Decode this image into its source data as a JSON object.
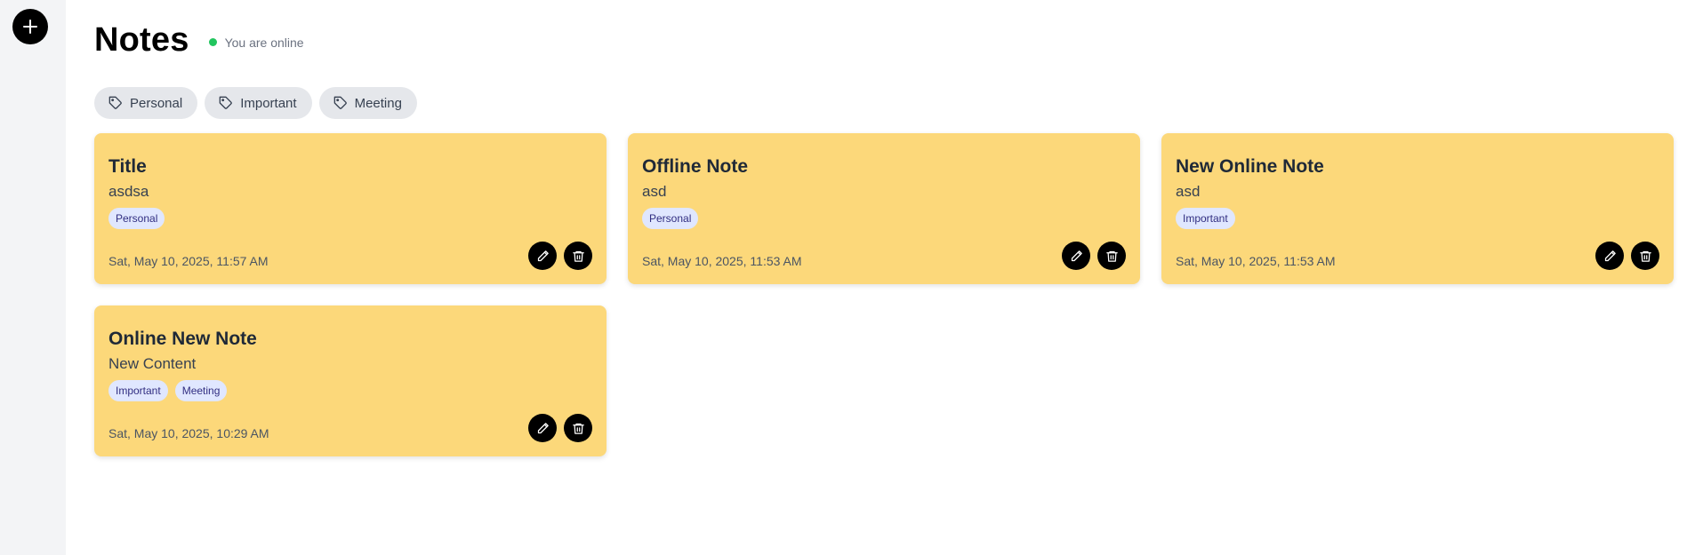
{
  "sidebar": {
    "add_button_icon": "plus-icon"
  },
  "header": {
    "title": "Notes",
    "status_text": "You are online",
    "status_color": "#22c55e"
  },
  "filters": [
    {
      "label": "Personal",
      "icon": "tag-icon"
    },
    {
      "label": "Important",
      "icon": "tag-icon"
    },
    {
      "label": "Meeting",
      "icon": "tag-icon"
    }
  ],
  "notes": [
    {
      "title": "Title",
      "content": "asdsa",
      "tags": [
        "Personal"
      ],
      "date": "Sat, May 10, 2025, 11:57 AM"
    },
    {
      "title": "Offline Note",
      "content": "asd",
      "tags": [
        "Personal"
      ],
      "date": "Sat, May 10, 2025, 11:53 AM"
    },
    {
      "title": "New Online Note",
      "content": "asd",
      "tags": [
        "Important"
      ],
      "date": "Sat, May 10, 2025, 11:53 AM"
    },
    {
      "title": "Online New Note",
      "content": "New Content",
      "tags": [
        "Important",
        "Meeting"
      ],
      "date": "Sat, May 10, 2025, 10:29 AM"
    }
  ],
  "colors": {
    "card_bg": "#fcd87a",
    "tag_bg": "#e0e7ff",
    "tag_text": "#312e81",
    "button_bg": "#000000"
  }
}
